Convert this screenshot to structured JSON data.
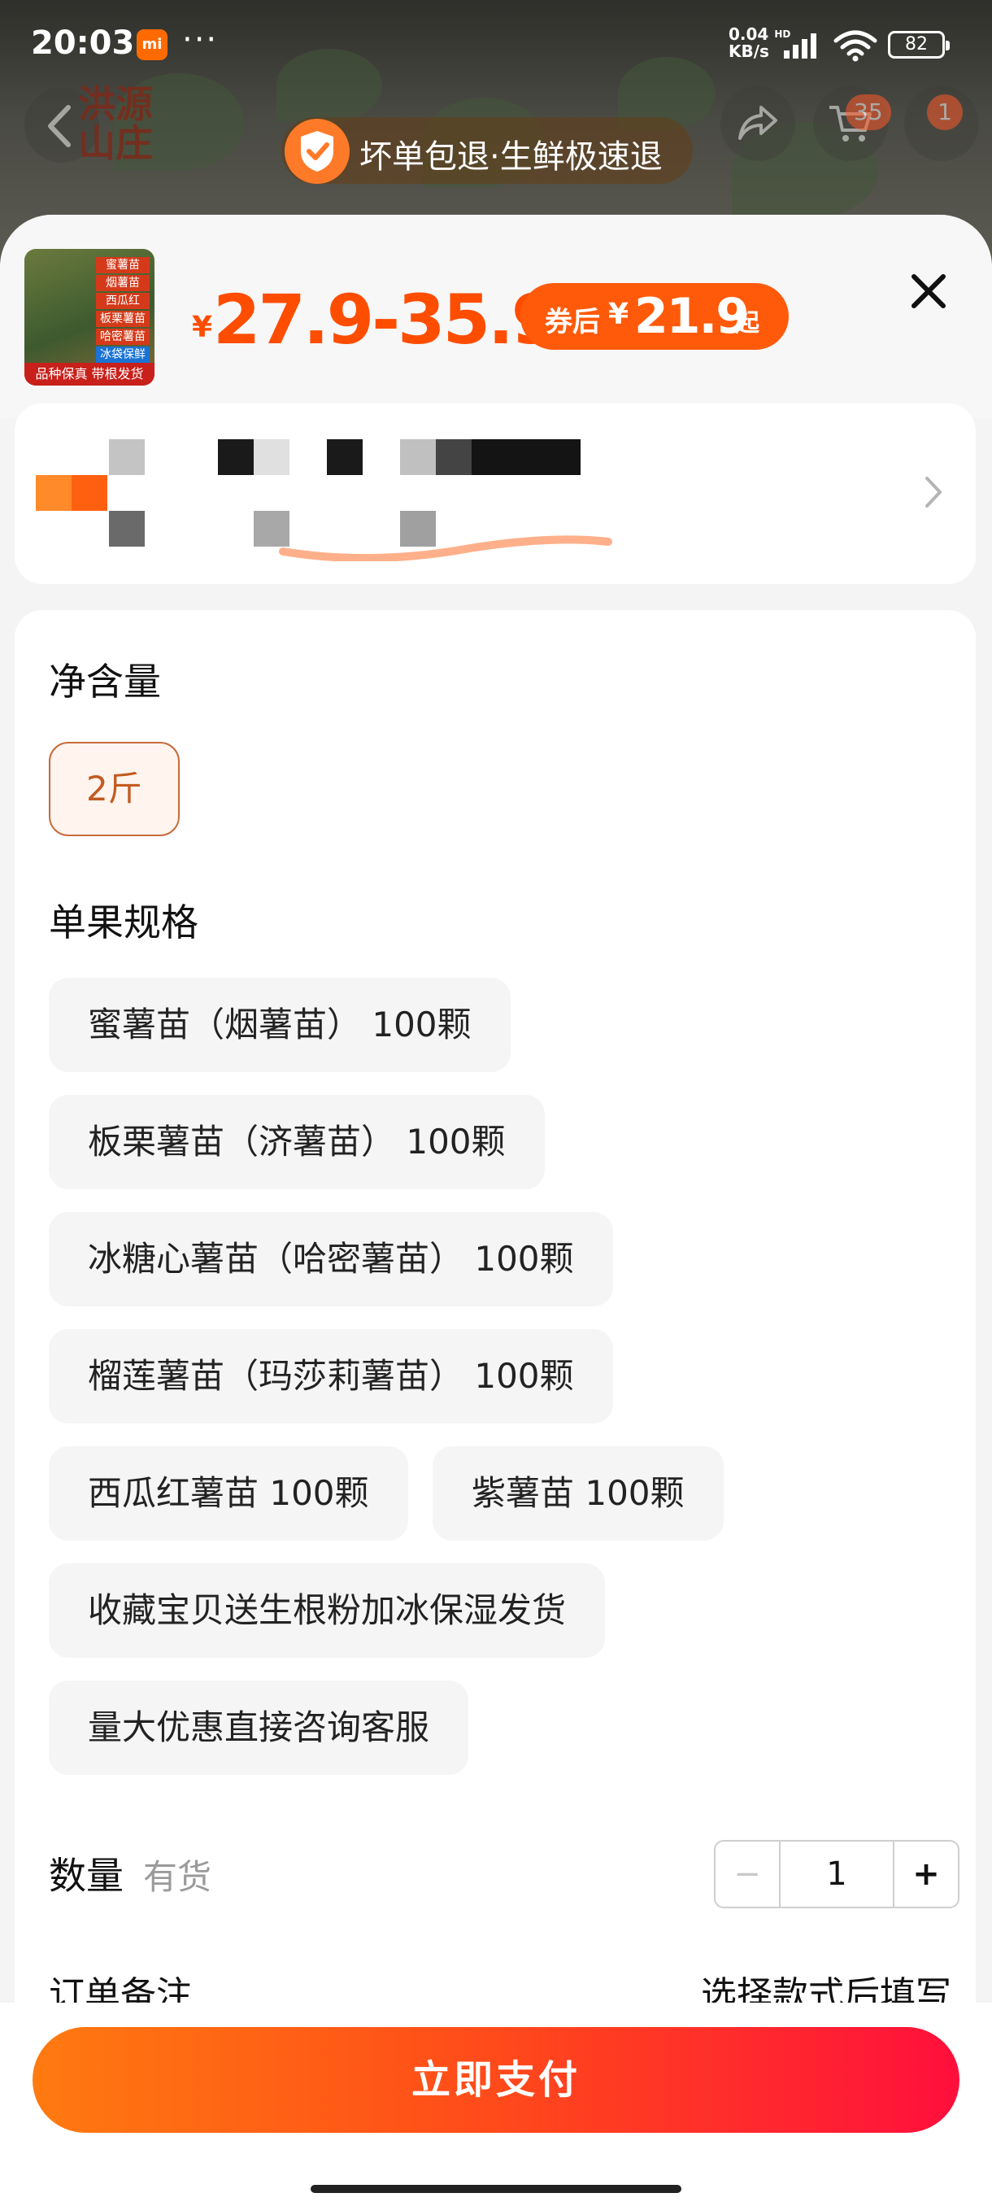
{
  "status_bar": {
    "time": "20:03",
    "mi_badge": "mi",
    "more_dots": "···",
    "net_speed_value": "0.04",
    "net_speed_unit": "KB/s",
    "hd_label": "HD",
    "battery": "82"
  },
  "nav": {
    "shop_mark": "洪源\n山庄",
    "cart_count": "35",
    "msg_count": "1"
  },
  "promo": {
    "text": "坏单包退·生鲜极速退"
  },
  "product": {
    "thumb_tags": [
      "蜜薯苗",
      "烟薯苗",
      "西瓜红",
      "板栗薯苗",
      "哈密薯苗",
      "冰袋保鲜"
    ],
    "thumb_footer": "品种保真 带根发货",
    "price_symbol": "¥",
    "price_range": "27.9-35.9",
    "coupon_prefix": "券后",
    "coupon_symbol": "¥",
    "coupon_value": "21.9",
    "coupon_suffix": "起"
  },
  "options": {
    "net_weight_title": "净含量",
    "net_weight_options": [
      "2斤"
    ],
    "spec_title": "单果规格",
    "spec_options": [
      "蜜薯苗（烟薯苗） 100颗",
      "板栗薯苗（济薯苗） 100颗",
      "冰糖心薯苗（哈密薯苗） 100颗",
      "榴莲薯苗（玛莎莉薯苗） 100颗",
      "西瓜红薯苗 100颗",
      "紫薯苗 100颗",
      "收藏宝贝送生根粉加冰保湿发货",
      "量大优惠直接咨询客服"
    ]
  },
  "quantity": {
    "label": "数量",
    "stock": "有货",
    "minus": "−",
    "value": "1",
    "plus": "+"
  },
  "remark": {
    "label": "订单备注",
    "hint": "选择款式后填写"
  },
  "footer": {
    "pay_label": "立即支付"
  },
  "colors": {
    "accent": "#ff4d00",
    "coupon_bg": "#ff5a0a",
    "pay_gradient_start": "#ff7a10",
    "pay_gradient_end": "#ff0f3c",
    "selected_border": "#c76b3a"
  }
}
